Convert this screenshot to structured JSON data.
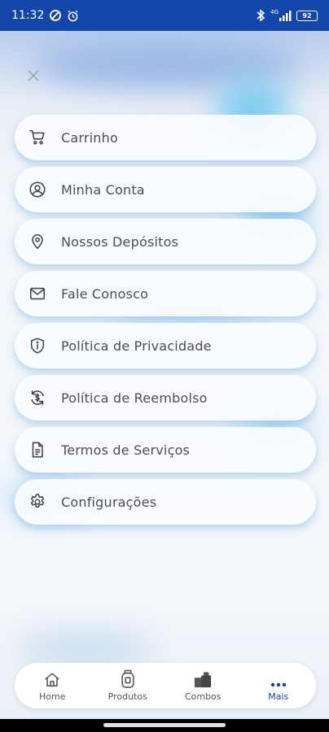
{
  "status_bar": {
    "time": "11:32",
    "network_label": "4G",
    "battery": "92"
  },
  "menu": {
    "items": [
      {
        "label": "Carrinho",
        "icon": "cart-icon"
      },
      {
        "label": "Minha Conta",
        "icon": "user-circle-icon"
      },
      {
        "label": "Nossos Depósitos",
        "icon": "location-pin-icon"
      },
      {
        "label": "Fale Conosco",
        "icon": "mail-icon"
      },
      {
        "label": "Política de Privacidade",
        "icon": "shield-info-icon"
      },
      {
        "label": "Política de Reembolso",
        "icon": "refund-cycle-icon"
      },
      {
        "label": "Termos de Serviços",
        "icon": "document-icon"
      },
      {
        "label": "Configurações",
        "icon": "gear-icon"
      }
    ]
  },
  "bottom_nav": {
    "tabs": [
      {
        "label": "Home",
        "icon": "home-icon"
      },
      {
        "label": "Produtos",
        "icon": "gas-cylinder-icon"
      },
      {
        "label": "Combos",
        "icon": "boxes-icon"
      },
      {
        "label": "Mais",
        "icon": "more-dots-icon",
        "active": true
      }
    ]
  },
  "colors": {
    "status_bar": "#1246a8",
    "accent": "#1a3c9e",
    "menu_text": "#4d4d4d",
    "menu_shadow": "#4696dc"
  }
}
